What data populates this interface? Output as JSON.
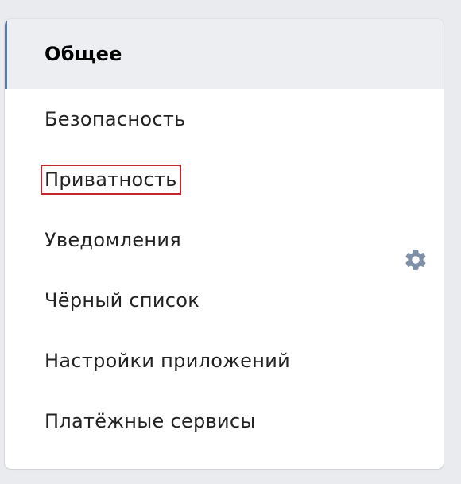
{
  "menu": {
    "items": [
      {
        "label": "Общее",
        "active": true
      },
      {
        "label": "Безопасность"
      },
      {
        "label": "Приватность",
        "highlighted": true
      },
      {
        "label": "Уведомления"
      },
      {
        "label": "Чёрный список"
      },
      {
        "label": "Настройки приложений"
      },
      {
        "label": "Платёжные сервисы"
      }
    ]
  },
  "icons": {
    "settings": "gear-icon"
  },
  "colors": {
    "active_bar": "#5b7aa5",
    "highlight_border": "#c0282d",
    "gear": "#7f90a6"
  }
}
